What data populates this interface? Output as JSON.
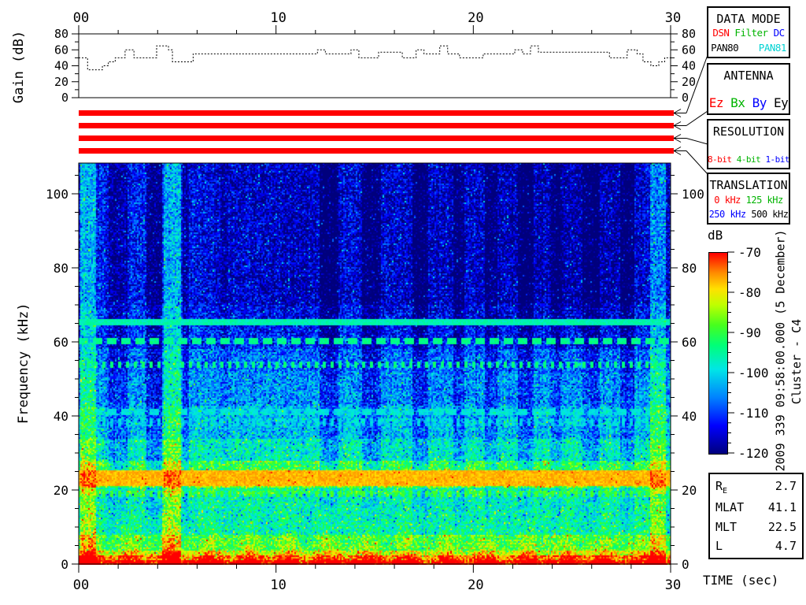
{
  "side_text": {
    "datetime": "2009 339 09:58:00.000 (5 December)",
    "spacecraft": "Cluster - C4"
  },
  "gain_panel": {
    "ylabel": "Gain (dB)",
    "ytick_labels": [
      "0",
      "20",
      "40",
      "60",
      "80"
    ],
    "xtick_labels": [
      "00",
      "10",
      "20",
      "30"
    ]
  },
  "freq_axis": {
    "label": "Frequency (kHz)",
    "tick_labels": [
      "0",
      "20",
      "40",
      "60",
      "80",
      "100"
    ]
  },
  "time_axis": {
    "label": "TIME (sec)",
    "tick_labels": [
      "00",
      "10",
      "20",
      "30"
    ]
  },
  "colorbar": {
    "title": "dB",
    "tick_labels": [
      "-70",
      "-80",
      "-90",
      "-100",
      "-110",
      "-120"
    ]
  },
  "status_bars": {
    "color": "#ff0000",
    "count": 4,
    "targets": [
      "DATA MODE",
      "ANTENNA",
      "RESOLUTION",
      "TRANSLATION"
    ]
  },
  "info_boxes": [
    {
      "id": "data-mode",
      "title": "DATA MODE",
      "rows": [
        {
          "items": [
            {
              "text": "DSN",
              "color": "#ff0000"
            },
            {
              "text": " ",
              "color": "#000000"
            },
            {
              "text": "Filter",
              "color": "#00b400"
            },
            {
              "text": " ",
              "color": "#000000"
            },
            {
              "text": "DC",
              "color": "#0000ff"
            }
          ],
          "size": 12.5,
          "justify": "center"
        },
        {
          "items": [
            {
              "text": "PAN80",
              "color": "#000000"
            },
            {
              "text": "PAN81",
              "color": "#00d2d2"
            }
          ],
          "size": 12.5,
          "justify": "space-between"
        }
      ]
    },
    {
      "id": "antenna",
      "title": "ANTENNA",
      "rows": [
        {
          "items": [
            {
              "text": "Ez",
              "color": "#ff0000"
            },
            {
              "text": " ",
              "color": "#000000"
            },
            {
              "text": "Bx",
              "color": "#00b400"
            },
            {
              "text": " ",
              "color": "#000000"
            },
            {
              "text": "By",
              "color": "#0000ff"
            },
            {
              "text": " ",
              "color": "#000000"
            },
            {
              "text": "Ey",
              "color": "#000000"
            }
          ],
          "size": 16,
          "justify": "center"
        }
      ]
    },
    {
      "id": "resolution",
      "title": "RESOLUTION",
      "rows": [
        {
          "items": [
            {
              "text": "8-bit",
              "color": "#ff0000"
            },
            {
              "text": " ",
              "color": "#000000"
            },
            {
              "text": "4-bit",
              "color": "#00b400"
            },
            {
              "text": " ",
              "color": "#000000"
            },
            {
              "text": "1-bit",
              "color": "#0000ff"
            }
          ],
          "size": 11,
          "justify": "center"
        }
      ]
    },
    {
      "id": "translation",
      "title": "TRANSLATION",
      "rows": [
        {
          "items": [
            {
              "text": "0 kHz",
              "color": "#ff0000"
            },
            {
              "text": " ",
              "color": "#000000"
            },
            {
              "text": "125 kHz",
              "color": "#00b400"
            }
          ],
          "size": 12,
          "justify": "center"
        },
        {
          "items": [
            {
              "text": "250 kHz",
              "color": "#0000ff"
            },
            {
              "text": " ",
              "color": "#000000"
            },
            {
              "text": "500 kHz",
              "color": "#000000"
            }
          ],
          "size": 12,
          "justify": "center"
        }
      ]
    }
  ],
  "ephemeris": {
    "rows": [
      {
        "label": "R",
        "sub": "E",
        "value": "2.7"
      },
      {
        "label": "MLAT",
        "sub": "",
        "value": "41.1"
      },
      {
        "label": "MLT",
        "sub": "",
        "value": "22.5"
      },
      {
        "label": "L",
        "sub": "",
        "value": "4.7"
      }
    ]
  },
  "chart_data": {
    "gain": {
      "type": "line",
      "ylabel": "Gain (dB)",
      "xlabel": "TIME (sec)",
      "xlim": [
        0,
        30
      ],
      "ylim": [
        0,
        80
      ],
      "x_ticks": [
        0,
        10,
        20,
        30
      ],
      "x_minor_step": 2,
      "y_ticks": [
        0,
        20,
        40,
        60,
        80
      ],
      "y_minor_step": 10,
      "step": true,
      "points": [
        [
          0,
          50
        ],
        [
          0.45,
          35
        ],
        [
          1.2,
          40
        ],
        [
          1.5,
          45
        ],
        [
          1.85,
          50
        ],
        [
          2.35,
          60
        ],
        [
          2.8,
          50
        ],
        [
          3.95,
          65
        ],
        [
          4.55,
          60
        ],
        [
          4.75,
          45
        ],
        [
          5.8,
          55
        ],
        [
          12.1,
          60
        ],
        [
          12.5,
          55
        ],
        [
          13.8,
          60
        ],
        [
          14.2,
          50
        ],
        [
          15.2,
          57
        ],
        [
          16.4,
          50
        ],
        [
          17.1,
          60
        ],
        [
          17.5,
          55
        ],
        [
          18.3,
          65
        ],
        [
          18.7,
          55
        ],
        [
          19.3,
          50
        ],
        [
          20.5,
          55
        ],
        [
          22.1,
          60
        ],
        [
          22.5,
          55
        ],
        [
          22.9,
          65
        ],
        [
          23.3,
          57
        ],
        [
          26.9,
          50
        ],
        [
          27.8,
          60
        ],
        [
          28.3,
          55
        ],
        [
          28.6,
          45
        ],
        [
          29.0,
          40
        ],
        [
          29.4,
          45
        ],
        [
          29.7,
          50
        ],
        [
          30,
          55
        ]
      ]
    },
    "spectrogram": {
      "type": "heatmap",
      "xlabel": "TIME (sec)",
      "ylabel": "Frequency (kHz)",
      "xlim": [
        0,
        30
      ],
      "ylim": [
        0,
        108.3
      ],
      "x_ticks": [
        0,
        10,
        20,
        30
      ],
      "x_minor_step": 2,
      "y_ticks": [
        0,
        20,
        40,
        60,
        80,
        100
      ],
      "y_minor_step": 5,
      "colorbar": {
        "label": "dB",
        "range": [
          -120,
          -70
        ],
        "ticks": [
          -70,
          -80,
          -90,
          -100,
          -110,
          -120
        ],
        "minor_step": 2.5,
        "stops": [
          {
            "db": -120,
            "rgb": [
              0,
              0,
              125
            ]
          },
          {
            "db": -113,
            "rgb": [
              0,
              0,
              255
            ]
          },
          {
            "db": -106,
            "rgb": [
              0,
              130,
              255
            ]
          },
          {
            "db": -99,
            "rgb": [
              0,
              230,
              230
            ]
          },
          {
            "db": -93,
            "rgb": [
              0,
              255,
              120
            ]
          },
          {
            "db": -88,
            "rgb": [
              70,
              255,
              30
            ]
          },
          {
            "db": -83,
            "rgb": [
              190,
              255,
              0
            ]
          },
          {
            "db": -79,
            "rgb": [
              255,
              225,
              0
            ]
          },
          {
            "db": -75,
            "rgb": [
              255,
              140,
              0
            ]
          },
          {
            "db": -70,
            "rgb": [
              255,
              0,
              0
            ]
          }
        ]
      },
      "base_profile_db": [
        [
          1.3,
          -71
        ],
        [
          2.6,
          -77
        ],
        [
          4,
          -84
        ],
        [
          8,
          -91
        ],
        [
          19,
          -97
        ],
        [
          21,
          -93
        ],
        [
          25.5,
          -85
        ],
        [
          28,
          -90
        ],
        [
          34,
          -97
        ],
        [
          43,
          -101.5
        ],
        [
          52,
          -104.5
        ],
        [
          58,
          -106.5
        ],
        [
          70,
          -109.5
        ],
        [
          109,
          -112
        ]
      ],
      "noise_db": 6.5,
      "interference_lines": [
        {
          "f": 65.4,
          "db": -96,
          "style": "solid"
        },
        {
          "f": 60.3,
          "db": -94,
          "style": "dashed"
        },
        {
          "f": 53.9,
          "db": -93,
          "style": "dotted"
        },
        {
          "f": 41.1,
          "db": -99,
          "style": "dashed"
        },
        {
          "f": 38.5,
          "db": -100,
          "style": "dotted"
        },
        {
          "f": 24.45,
          "db": -77,
          "style": "solid"
        },
        {
          "f": 22.25,
          "db": -77,
          "style": "solid"
        },
        {
          "f": 19.1,
          "db": -89,
          "style": "dotted"
        }
      ],
      "bright_columns": [
        [
          0.05,
          0.85,
          9.5
        ],
        [
          4.25,
          5.2,
          9.5
        ],
        [
          28.95,
          29.75,
          10
        ]
      ],
      "dark_columns": [
        [
          1.55,
          2.5,
          7
        ],
        [
          3.45,
          4.3,
          8
        ],
        [
          5.25,
          5.6,
          6
        ],
        [
          7.15,
          7.6,
          4
        ],
        [
          12.2,
          13.2,
          7
        ],
        [
          14.35,
          15.3,
          7
        ],
        [
          16.9,
          17.75,
          7
        ],
        [
          18.95,
          19.55,
          6
        ],
        [
          20.6,
          21.25,
          6
        ],
        [
          22.3,
          23.05,
          7
        ],
        [
          23.95,
          24.5,
          5
        ],
        [
          25.5,
          26.4,
          6
        ],
        [
          27.45,
          28.2,
          7
        ]
      ],
      "burst_train": {
        "start": 0.65,
        "period": 2.0,
        "count": 15,
        "amp_db": 11,
        "sigma_s": 0.45,
        "f_scale_khz": 10
      },
      "high_f_darkening": [
        [
          0,
          0
        ],
        [
          5,
          0
        ],
        [
          7,
          3
        ],
        [
          12,
          4.5
        ],
        [
          14,
          3
        ],
        [
          21,
          4
        ],
        [
          24,
          5.5
        ],
        [
          27,
          5.5
        ],
        [
          28.6,
          3
        ],
        [
          30,
          3
        ]
      ]
    }
  }
}
